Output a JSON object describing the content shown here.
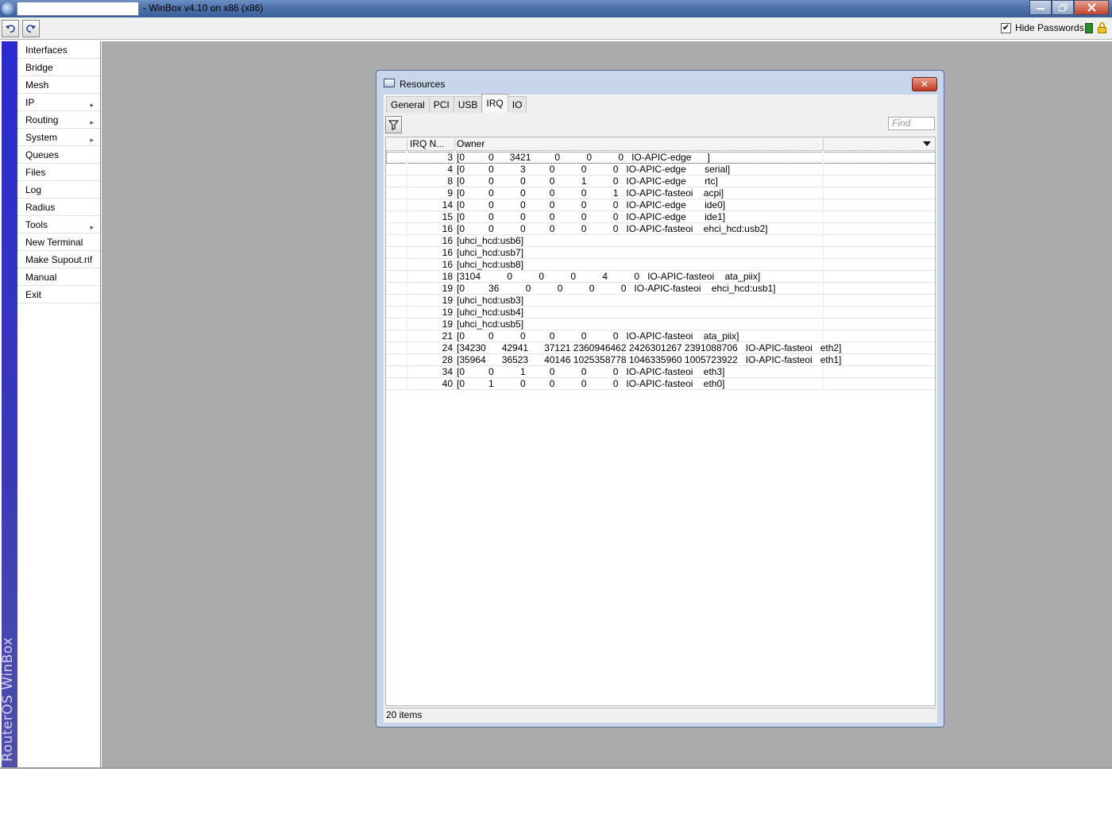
{
  "app": {
    "title": "- WinBox v4.10 on x86 (x86)",
    "title_input_value": "",
    "brand": "RouterOS WinBox"
  },
  "toolbar": {
    "hide_passwords_label": "Hide Passwords",
    "hide_passwords_checked": true
  },
  "menu": {
    "items": [
      {
        "label": "Interfaces",
        "submenu": false
      },
      {
        "label": "Bridge",
        "submenu": false
      },
      {
        "label": "Mesh",
        "submenu": false
      },
      {
        "label": "IP",
        "submenu": true
      },
      {
        "label": "Routing",
        "submenu": true
      },
      {
        "label": "System",
        "submenu": true
      },
      {
        "label": "Queues",
        "submenu": false
      },
      {
        "label": "Files",
        "submenu": false
      },
      {
        "label": "Log",
        "submenu": false
      },
      {
        "label": "Radius",
        "submenu": false
      },
      {
        "label": "Tools",
        "submenu": true
      },
      {
        "label": "New Terminal",
        "submenu": false
      },
      {
        "label": "Make Supout.rif",
        "submenu": false
      },
      {
        "label": "Manual",
        "submenu": false
      },
      {
        "label": "Exit",
        "submenu": false
      }
    ]
  },
  "dialog": {
    "title": "Resources",
    "close_label": "✕",
    "tabs": [
      "General",
      "PCI",
      "USB",
      "IRQ",
      "IO"
    ],
    "active_tab": "IRQ",
    "find_placeholder": "Find",
    "columns": {
      "irq": "IRQ N...",
      "owner": "Owner"
    },
    "rows": [
      {
        "irq": "3",
        "owner": "[0         0      3421         0          0          0   IO-APIC-edge      ]"
      },
      {
        "irq": "4",
        "owner": "[0         0          3         0          0          0   IO-APIC-edge       serial]"
      },
      {
        "irq": "8",
        "owner": "[0         0          0         0          1          0   IO-APIC-edge       rtc]"
      },
      {
        "irq": "9",
        "owner": "[0         0          0         0          0          1   IO-APIC-fasteoi    acpi]"
      },
      {
        "irq": "14",
        "owner": "[0         0          0         0          0          0   IO-APIC-edge       ide0]"
      },
      {
        "irq": "15",
        "owner": "[0         0          0         0          0          0   IO-APIC-edge       ide1]"
      },
      {
        "irq": "16",
        "owner": "[0         0          0         0          0          0   IO-APIC-fasteoi    ehci_hcd:usb2]"
      },
      {
        "irq": "16",
        "owner": "[uhci_hcd:usb6]"
      },
      {
        "irq": "16",
        "owner": "[uhci_hcd:usb7]"
      },
      {
        "irq": "16",
        "owner": "[uhci_hcd:usb8]"
      },
      {
        "irq": "18",
        "owner": "[3104          0          0          0          4          0   IO-APIC-fasteoi    ata_piix]"
      },
      {
        "irq": "19",
        "owner": "[0         36          0          0          0          0   IO-APIC-fasteoi    ehci_hcd:usb1]"
      },
      {
        "irq": "19",
        "owner": "[uhci_hcd:usb3]"
      },
      {
        "irq": "19",
        "owner": "[uhci_hcd:usb4]"
      },
      {
        "irq": "19",
        "owner": "[uhci_hcd:usb5]"
      },
      {
        "irq": "21",
        "owner": "[0         0          0         0          0          0   IO-APIC-fasteoi    ata_piix]"
      },
      {
        "irq": "24",
        "owner": "[34230      42941      37121 2360946462 2426301267 2391088706   IO-APIC-fasteoi   eth2]"
      },
      {
        "irq": "28",
        "owner": "[35964      36523      40146 1025358778 1046335960 1005723922   IO-APIC-fasteoi   eth1]"
      },
      {
        "irq": "34",
        "owner": "[0         0          1         0          0          0   IO-APIC-fasteoi    eth3]"
      },
      {
        "irq": "40",
        "owner": "[0         1          0         0          0          0   IO-APIC-fasteoi    eth0]"
      }
    ],
    "selected_row": 0,
    "status": "20 items"
  },
  "icons": {
    "undo": "undo-icon",
    "redo": "redo-icon",
    "filter": "filter-icon",
    "lock": "lock-icon"
  },
  "colors": {
    "workspace": "#ababab",
    "brand_bar": "#2a2ad0",
    "secure_indicator": "#2d8a2d"
  }
}
